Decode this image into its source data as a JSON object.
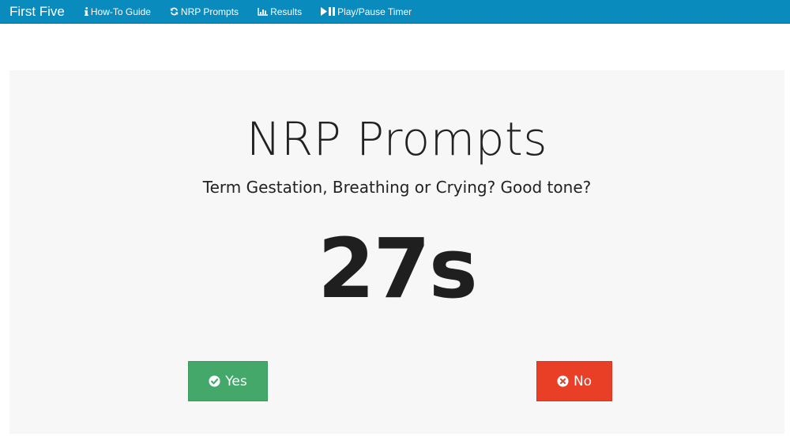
{
  "navbar": {
    "brand": "First Five",
    "background": "#0a8bbd",
    "links": [
      {
        "label": "How-To Guide",
        "icon": "info-icon"
      },
      {
        "label": "NRP Prompts",
        "icon": "refresh-icon"
      },
      {
        "label": "Results",
        "icon": "bar-chart-icon"
      },
      {
        "label": "Play/Pause Timer",
        "icon": "play-pause-icon"
      }
    ]
  },
  "main": {
    "title": "NRP Prompts",
    "question": "Term Gestation, Breathing or Crying? Good tone?",
    "timer": "27s",
    "yes_button": {
      "label": "Yes",
      "icon": "check-circle-icon",
      "color": "#43a86a"
    },
    "no_button": {
      "label": "No",
      "icon": "times-circle-icon",
      "color": "#ea3f27"
    }
  }
}
